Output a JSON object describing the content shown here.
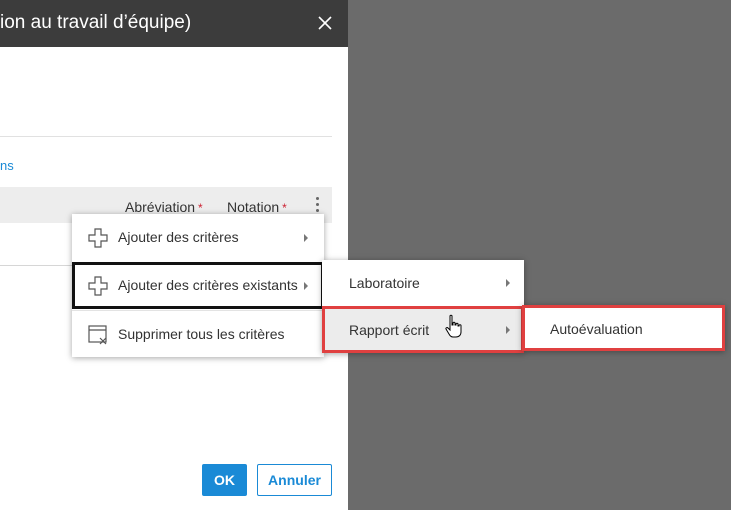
{
  "dialog": {
    "title": "ion au travail d’équipe)",
    "link_text": "ns",
    "table": {
      "columns": [
        {
          "label": "Abréviation",
          "required_mark": "*"
        },
        {
          "label": "Notation",
          "required_mark": "*"
        }
      ]
    },
    "buttons": {
      "ok": "OK",
      "cancel": "Annuler"
    }
  },
  "menu": {
    "items": [
      {
        "label": "Ajouter des critères",
        "icon": "plus-icon",
        "has_submenu": true
      },
      {
        "label": "Ajouter des critères existants",
        "icon": "plus-icon",
        "has_submenu": true,
        "highlighted": true
      },
      {
        "label": "Supprimer tous les critères",
        "icon": "delete-table-icon",
        "has_submenu": false
      }
    ]
  },
  "submenu": {
    "items": [
      {
        "label": "Laboratoire",
        "has_submenu": true
      },
      {
        "label": "Rapport écrit",
        "has_submenu": true,
        "hovered": true
      }
    ]
  },
  "subsubmenu": {
    "items": [
      {
        "label": "Autoévaluation"
      }
    ]
  },
  "colors": {
    "accent": "#1a8ad6",
    "titlebar": "#3c3c3c",
    "overlay": "#6b6b6b",
    "highlight_red": "#e04040",
    "required": "#cc2233"
  }
}
